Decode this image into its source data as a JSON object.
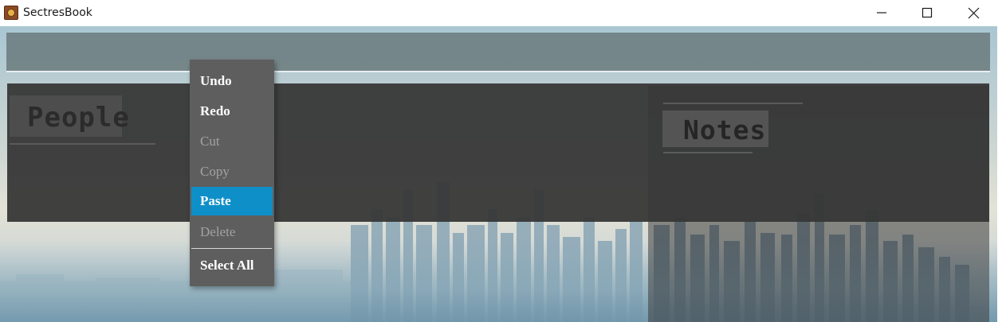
{
  "window": {
    "title": "SectresBook",
    "icon": "book-icon",
    "controls": [
      "minimize-icon",
      "maximize-icon",
      "close-icon"
    ]
  },
  "panels": {
    "people": {
      "title": "People"
    },
    "notes": {
      "title": "Notes"
    }
  },
  "context_menu": {
    "items": [
      {
        "label": "Undo",
        "enabled": true,
        "selected": false
      },
      {
        "label": "Redo",
        "enabled": true,
        "selected": false
      },
      {
        "label": "Cut",
        "enabled": false,
        "selected": false
      },
      {
        "label": "Copy",
        "enabled": false,
        "selected": false
      },
      {
        "label": "Paste",
        "enabled": true,
        "selected": true
      },
      {
        "label": "Delete",
        "enabled": false,
        "selected": false
      },
      {
        "label": "Select All",
        "enabled": true,
        "selected": false
      }
    ]
  },
  "colors": {
    "menu_background": "#5e5e5e",
    "menu_highlight": "#0f8fc8",
    "menu_disabled_text": "#a3a3a3",
    "panel_background": "#373737"
  }
}
